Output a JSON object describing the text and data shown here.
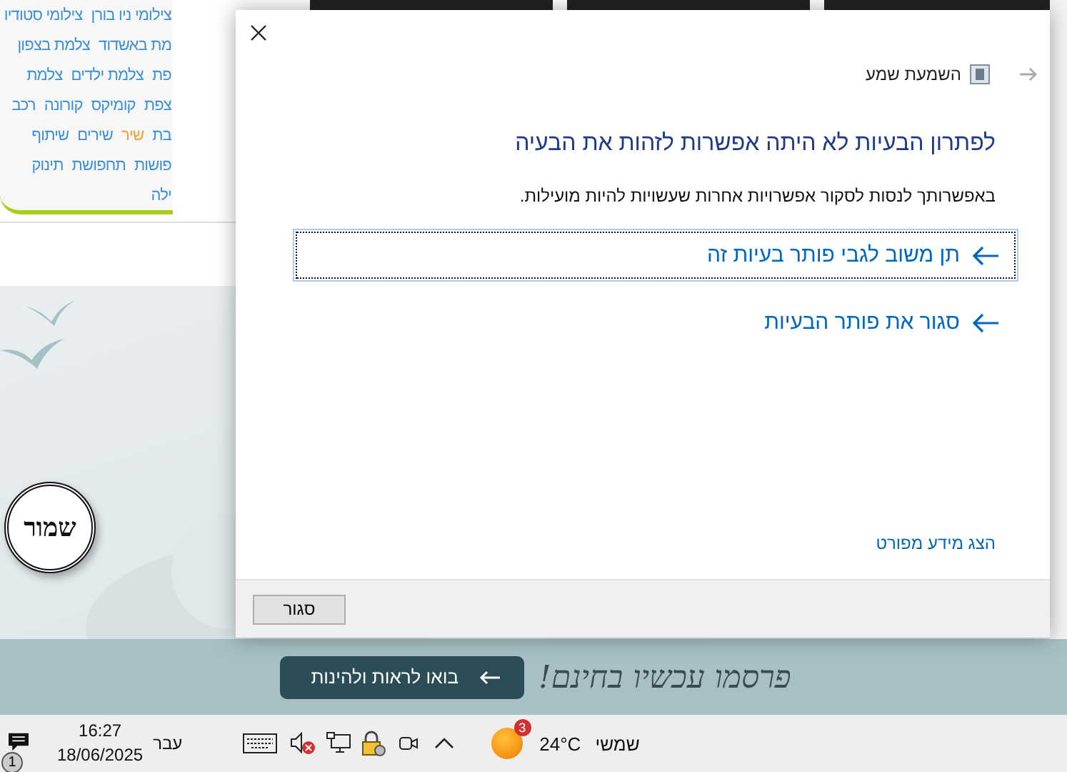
{
  "tag_cloud": {
    "lines": [
      {
        "tags": [
          {
            "text": "צילומי ניו בורן",
            "color": "#3d8fd6"
          },
          {
            "text": "צילומי סטודיו",
            "color": "#3d8fd6"
          }
        ]
      },
      {
        "tags": [
          {
            "text": "מת באשדוד",
            "color": "#3d8fd6"
          },
          {
            "text": "צלמת בצפון",
            "color": "#3d8fd6"
          }
        ]
      },
      {
        "tags": [
          {
            "text": "פת",
            "color": "#3d8fd6"
          },
          {
            "text": "צלמת ילדים",
            "color": "#3d8fd6"
          },
          {
            "text": "צלמת",
            "color": "#3d8fd6"
          }
        ]
      },
      {
        "tags": [
          {
            "text": "צפת",
            "color": "#3d8fd6"
          },
          {
            "text": "קומיקס",
            "color": "#3d8fd6"
          },
          {
            "text": "קורונה",
            "color": "#3d8fd6"
          },
          {
            "text": "רכב",
            "color": "#3d8fd6"
          }
        ]
      },
      {
        "tags": [
          {
            "text": "בת",
            "color": "#3d8fd6"
          },
          {
            "text": "שיר",
            "color": "#f0a030"
          },
          {
            "text": "שירים",
            "color": "#3d8fd6"
          },
          {
            "text": "שיתוף",
            "color": "#3d8fd6"
          }
        ]
      },
      {
        "tags": [
          {
            "text": "פושות",
            "color": "#3d8fd6"
          },
          {
            "text": "תחפושת",
            "color": "#3d8fd6"
          },
          {
            "text": "תינוק",
            "color": "#3d8fd6"
          }
        ]
      },
      {
        "tags": [
          {
            "text": "ילה",
            "color": "#3d8fd6"
          }
        ]
      }
    ]
  },
  "seal_logo": {
    "text": "שמור"
  },
  "banner": {
    "headline": "פרסמו עכשיו בחינם!",
    "button": "בואו לראות ולהינות"
  },
  "dialog": {
    "nav_title": "השמעת שמע",
    "heading": "לפתרון הבעיות לא היתה אפשרות לזהות את הבעיה",
    "description": "באפשרותך לנסות לסקור אפשרויות אחרות שעשויות להיות מועילות.",
    "options": [
      {
        "label": "תן משוב לגבי פותר בעיות זה",
        "focused": true
      },
      {
        "label": "סגור את פותר הבעיות",
        "focused": false
      }
    ],
    "details_link": "הצג מידע מפורט",
    "close_button": "סגור"
  },
  "taskbar": {
    "notification_badge": "1",
    "time": "16:27",
    "date": "18/06/2025",
    "language": "עבר",
    "weather_badge": "3",
    "temperature": "24°C",
    "weather": "שמשי"
  }
}
